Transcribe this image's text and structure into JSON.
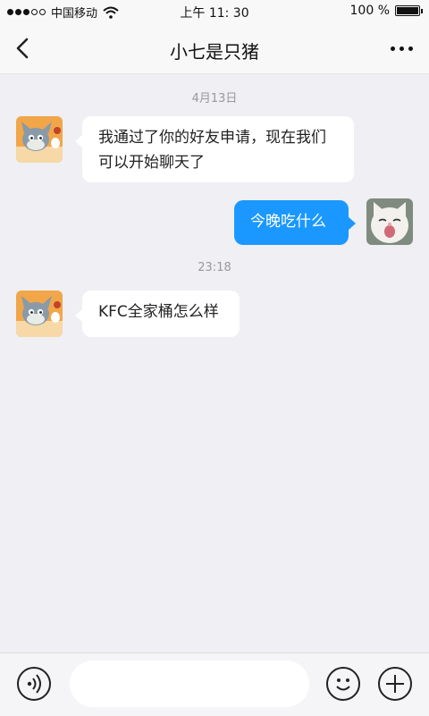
{
  "status_bar": {
    "carrier": "中国移动",
    "time": "上午 11: 30",
    "battery": "100 %",
    "battery_level": 1.0
  },
  "header": {
    "back_icon": "chevron-left-icon",
    "title": "小七是只猪",
    "more_icon": "more-dots-icon"
  },
  "messages": [
    {
      "type": "timestamp",
      "text": "4月13日"
    },
    {
      "type": "message",
      "direction": "incoming",
      "text": "我通过了你的好友申请，现在我们可以开始聊天了",
      "avatar": "tom-cat-avatar"
    },
    {
      "type": "message",
      "direction": "outgoing",
      "text": "今晚吃什么",
      "avatar": "white-kitten-avatar"
    },
    {
      "type": "timestamp",
      "text": "23:18"
    },
    {
      "type": "message",
      "direction": "incoming",
      "text": "KFC全家桶怎么样",
      "avatar": "tom-cat-avatar"
    }
  ],
  "input_bar": {
    "voice_icon": "voice-icon",
    "text_value": "",
    "emoji_icon": "emoji-icon",
    "add_icon": "add-icon"
  },
  "colors": {
    "outgoing_bubble": "#1a98ff",
    "incoming_bubble": "#ffffff",
    "background": "#efeff4"
  }
}
